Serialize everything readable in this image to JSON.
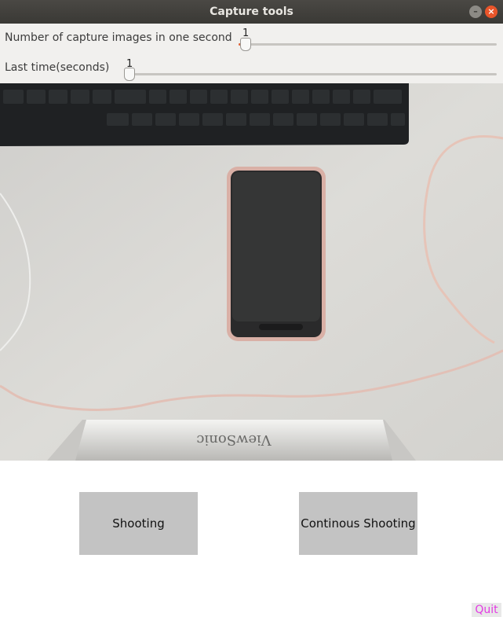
{
  "window": {
    "title": "Capture tools",
    "minimize_icon": "minimize-icon",
    "close_icon": "close-icon",
    "minimize_glyph": "–",
    "close_glyph": "×"
  },
  "controls": {
    "rate_label": "Number of capture images in one second",
    "rate_value": "1",
    "duration_label": "Last time(seconds)",
    "duration_value": "1"
  },
  "camera": {
    "brand_text": "ViewSonic"
  },
  "buttons": {
    "shooting": "Shooting",
    "continuous": "Continous Shooting",
    "quit": "Quit"
  },
  "colors": {
    "accent": "#e0643a",
    "quit_text": "#e33be3",
    "button_bg": "#c3c3c3"
  }
}
